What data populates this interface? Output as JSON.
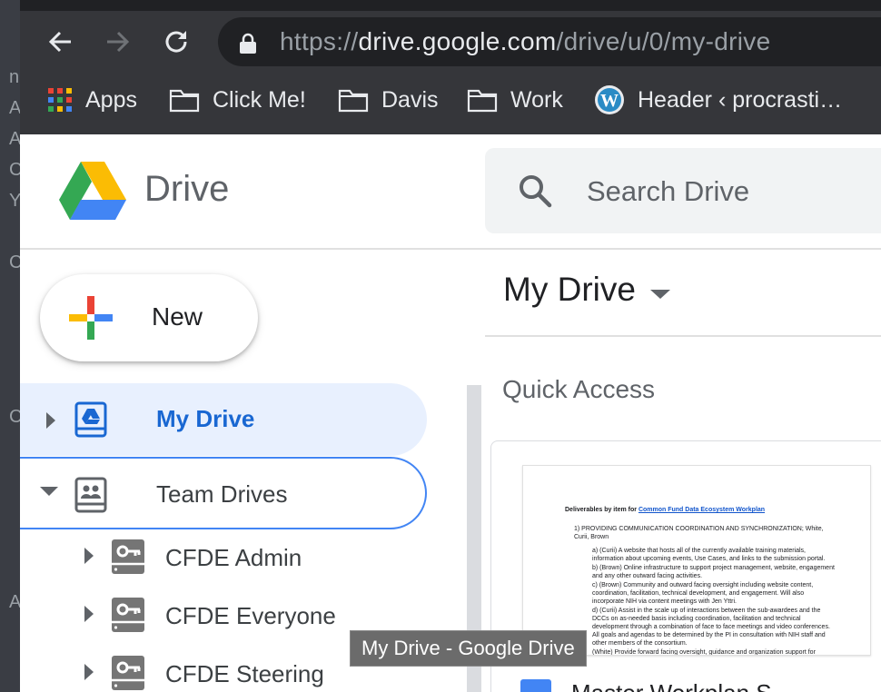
{
  "backdrop": {
    "glyphs": [
      "n",
      "A",
      "A",
      "C",
      "Y",
      "C",
      "C",
      "A"
    ]
  },
  "browser": {
    "url_scheme": "https://",
    "url_host": "drive.google.com",
    "url_path": "/drive/u/0/my-drive",
    "bookmarks": [
      {
        "label": "Apps",
        "icon": "apps-grid-icon"
      },
      {
        "label": "Click Me!",
        "icon": "folder-icon"
      },
      {
        "label": "Davis",
        "icon": "folder-icon"
      },
      {
        "label": "Work",
        "icon": "folder-icon"
      },
      {
        "label": "Header ‹ procrasti…",
        "icon": "wordpress-icon"
      }
    ]
  },
  "header": {
    "product_name": "Drive",
    "search_placeholder": "Search Drive"
  },
  "sidebar": {
    "new_label": "New",
    "items": [
      {
        "label": "My Drive",
        "selected": true
      },
      {
        "label": "Team Drives",
        "selected": false
      }
    ],
    "team_drives": [
      {
        "label": "CFDE Admin"
      },
      {
        "label": "CFDE Everyone"
      },
      {
        "label": "CFDE Steering"
      }
    ]
  },
  "main": {
    "title": "My Drive",
    "quick_access_title": "Quick Access",
    "card": {
      "file_name": "Master Workplan S",
      "doc_heading": "Deliverables by item for",
      "doc_heading_link": "Common Fund Data Ecosystem Workplan",
      "doc_lines": [
        "1)  PROVIDING COMMUNICATION COORDINATION AND SYNCHRONIZATION; White, Curii, Brown",
        "a)  (Curii)  A website that hosts all of the currently available training materials, information about upcoming events, Use Cases, and links to the submission portal.",
        "b)  (Brown) Online infrastructure to support project management, website, engagement and any other outward facing activities.",
        "c)  (Brown) Community and outward facing oversight including website content, coordination, facilitation, technical development, and engagement. Will also incorporate NIH via content meetings with Jen Yttri.",
        "d)  (Curii) Assist in the scale up of interactions between the sub-awardees and the DCCs on as-needed basis including coordination, facilitation and technical development through a combination of face to face meetings and video conferences. All goals and agendas to be determined by the PI in consultation with NIH staff and other members of the consortium.",
        "(White) Provide forward facing oversight, guidance and organization support for"
      ]
    }
  },
  "tooltip": "My Drive - Google Drive",
  "colors": {
    "chrome_bg": "#35363a",
    "accent_blue": "#1967d2",
    "selected_bg": "#e8f0fe"
  }
}
